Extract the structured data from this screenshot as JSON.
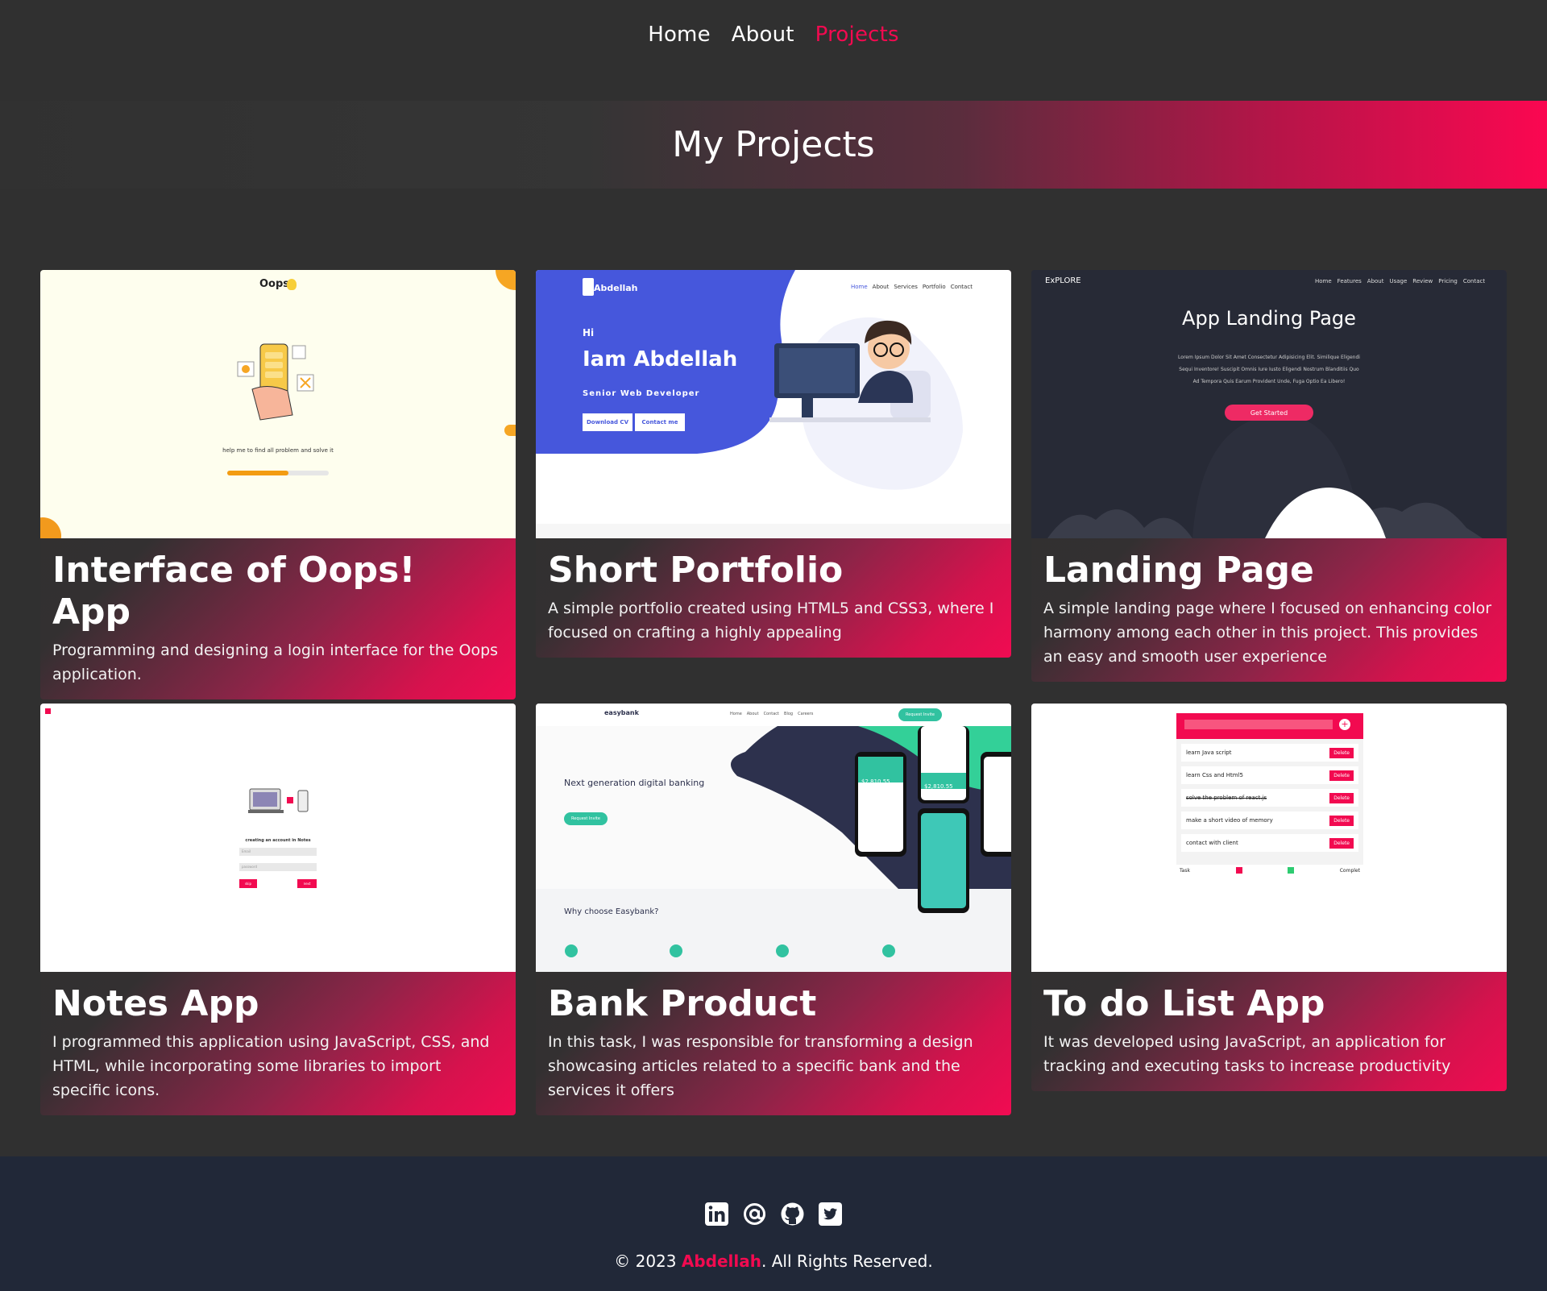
{
  "nav": {
    "items": [
      {
        "label": "Home"
      },
      {
        "label": "About"
      },
      {
        "label": "Projects"
      }
    ]
  },
  "hero": {
    "title": "My Projects"
  },
  "projects": [
    {
      "title": "Interface of Oops! App",
      "description": "Programming and designing a login interface for the Oops application.",
      "thumb": {
        "brand": "Oops",
        "caption": "help me to find all problem and solve it",
        "progress": 0.6
      }
    },
    {
      "title": "Short Portfolio",
      "description": "A simple portfolio created using HTML5 and CSS3, where I focused on crafting a highly appealing",
      "thumb": {
        "logo": "Abdellah",
        "nav": [
          "Home",
          "About",
          "Services",
          "Portfolio",
          "Contact"
        ],
        "greeting": "Hi",
        "headline": "Iam Abdellah",
        "role": "Senior Web Developer",
        "btn1": "Download CV",
        "btn2": "Contact me"
      }
    },
    {
      "title": "Landing Page",
      "description": "A simple landing page where I focused on enhancing color harmony among each other in this project. This provides an easy and smooth user experience",
      "thumb": {
        "logo": "ExPLORE",
        "nav": [
          "Home",
          "Features",
          "About",
          "Usage",
          "Review",
          "Pricing",
          "Contact"
        ],
        "headline": "App Landing Page",
        "lines": [
          "Lorem Ipsum Dolor Sit Amet Consectetur Adipisicing Elit. Similique Eligendi",
          "Sequi Inventore! Suscipit Omnis Iure Iusto Eligendi Nostrum Blanditiis Quo",
          "Ad Tempora Quis Earum Provident Unde, Fuga Optio Ea Libero!"
        ],
        "cta": "Get Started"
      }
    },
    {
      "title": "Notes App",
      "description": "I programmed this application using JavaScript, CSS, and HTML, while incorporating some libraries to import specific icons.",
      "thumb": {
        "caption": "creating an account in Notes",
        "field1": "Email",
        "field2": "password",
        "btn1": "skip",
        "btn2": "next"
      }
    },
    {
      "title": "Bank Product",
      "description": "In this task, I was responsible for transforming a design showcasing articles related to a specific bank and the services it offers",
      "thumb": {
        "logo": "easybank",
        "nav": [
          "Home",
          "About",
          "Contact",
          "Blog",
          "Careers"
        ],
        "cta": "Request Invite",
        "headline": "Next generation digital banking",
        "sub": "Why choose Easybank?",
        "amount1": "$2,810.55",
        "amount2": "$2,810.55"
      }
    },
    {
      "title": "To do List App",
      "description": "It was developed using JavaScript, an application for tracking and executing tasks to increase productivity",
      "thumb": {
        "tasks": [
          "learn Java script",
          "learn Css and Html5",
          "solve the problem of react.js",
          "make a short video of memory",
          "contact with client"
        ],
        "delete": "Delete",
        "footer_left": "Task",
        "footer_right": "Complet"
      }
    }
  ],
  "footer": {
    "icons": [
      "linkedin-icon",
      "at-icon",
      "github-icon",
      "twitter-icon"
    ],
    "copy_prefix": "© 2023 ",
    "brand": "Abdellah",
    "copy_suffix": ". All Rights Reserved."
  }
}
